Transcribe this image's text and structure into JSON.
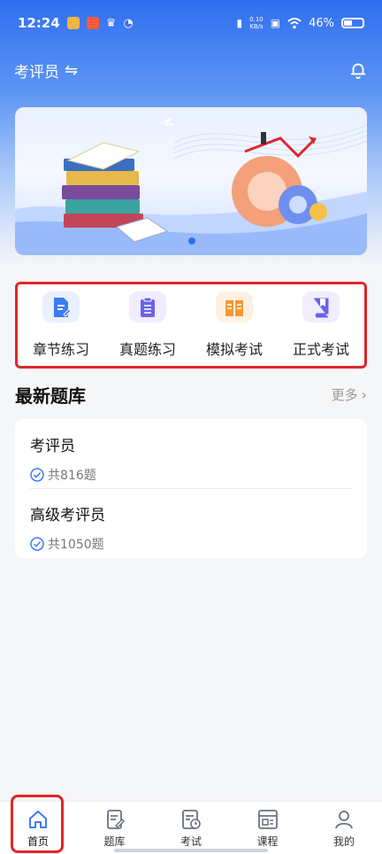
{
  "status_bar": {
    "time": "12:24",
    "network_speed_value": "0.10",
    "network_speed_unit": "KB/s",
    "battery_percent": "46%"
  },
  "header": {
    "role_label": "考评员",
    "swap_symbol": "⇋"
  },
  "banner": {
    "active_slide_index": 0
  },
  "quick_actions": [
    {
      "label": "章节练习",
      "icon": "chapter-practice-icon",
      "color": "#3b7df5",
      "bg": "#e9f0ff"
    },
    {
      "label": "真题练习",
      "icon": "past-paper-icon",
      "color": "#6b62e8",
      "bg": "#efedff"
    },
    {
      "label": "模拟考试",
      "icon": "mock-exam-icon",
      "color": "#f39a35",
      "bg": "#fff1e2"
    },
    {
      "label": "正式考试",
      "icon": "formal-exam-icon",
      "color": "#6b62e8",
      "bg": "#efedff"
    }
  ],
  "latest": {
    "title": "最新题库",
    "more_label": "更多",
    "items": [
      {
        "title": "考评员",
        "count_text": "共816题"
      },
      {
        "title": "高级考评员",
        "count_text": "共1050题"
      }
    ]
  },
  "tabbar": {
    "tabs": [
      {
        "label": "首页",
        "icon": "home-icon",
        "active": true
      },
      {
        "label": "题库",
        "icon": "question-bank-icon",
        "active": false
      },
      {
        "label": "考试",
        "icon": "exam-icon",
        "active": false
      },
      {
        "label": "课程",
        "icon": "course-icon",
        "active": false
      },
      {
        "label": "我的",
        "icon": "profile-icon",
        "active": false
      }
    ]
  },
  "colors": {
    "accent": "#2f6ff0",
    "highlight_border": "#e0262a"
  }
}
